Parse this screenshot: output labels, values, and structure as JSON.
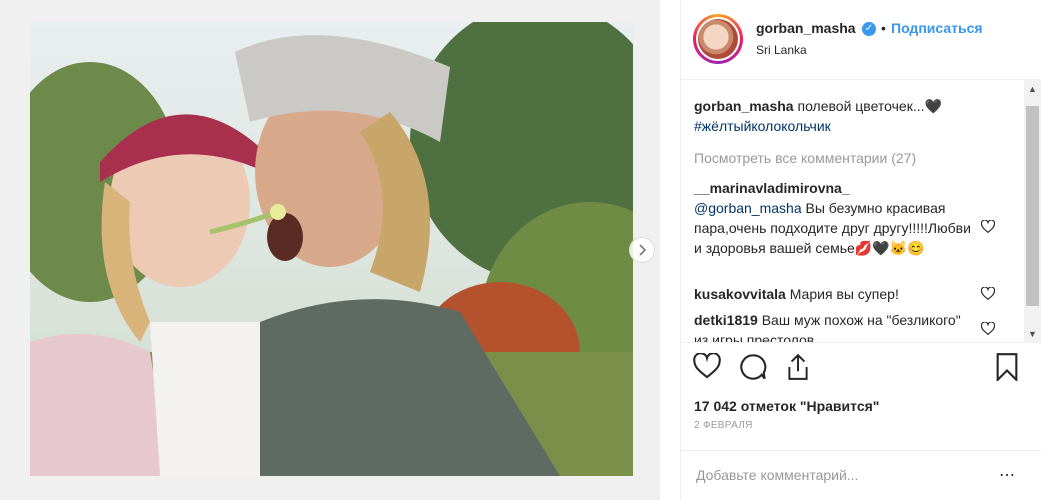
{
  "header": {
    "username": "gorban_masha",
    "dot": "•",
    "follow_label": "Подписаться",
    "location": "Sri Lanka"
  },
  "caption": {
    "user": "gorban_masha",
    "text": "полевой цветочек...🖤",
    "hashtag": "#жёлтыйколокольчик"
  },
  "view_all_comments": "Посмотреть все комментарии (27)",
  "comments": [
    {
      "user": "__marinavladimirovna_",
      "mention": "@gorban_masha",
      "text": "Вы безумно красивая пара,очень подходите друг другу!!!!!Любви и здоровья вашей семье💋🖤🐱😊"
    },
    {
      "user": "kusakovvitala",
      "text": "Мария вы супер!"
    },
    {
      "user": "detki1819",
      "text": "Ваш муж похож на \"безликого\" из игры престолов"
    }
  ],
  "likes_text": "17 042 отметок \"Нравится\"",
  "date": "2 февраля",
  "add_comment_placeholder": "Добавьте комментарий...",
  "more_glyph": "⋯",
  "colors": {
    "accent": "#3897f0",
    "text": "#262626",
    "muted": "#999999",
    "link": "#003569"
  },
  "icons": [
    "verified-badge-icon",
    "next-arrow-icon",
    "heart-icon",
    "comment-icon",
    "share-icon",
    "bookmark-icon",
    "more-options-icon"
  ]
}
